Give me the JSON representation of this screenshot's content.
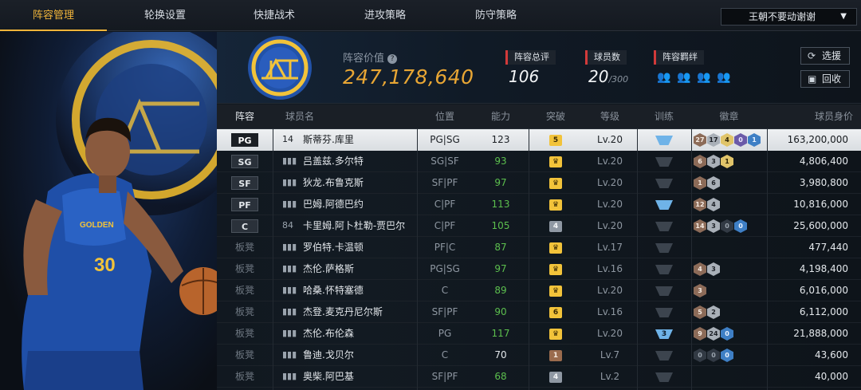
{
  "nav": {
    "tabs": [
      "阵容管理",
      "轮换设置",
      "快捷战术",
      "进攻策略",
      "防守策略"
    ],
    "active_tab": "阵容管理",
    "team_select": "王朝不要动谢谢"
  },
  "header": {
    "value_label": "阵容价值",
    "value": "247,178,640",
    "overall_label": "阵容总评",
    "overall": "106",
    "count_label": "球员数",
    "count": "20",
    "count_max": "/300",
    "chem_label": "阵容羁绊",
    "btn_pick": "选援",
    "btn_return": "回收"
  },
  "table": {
    "columns": [
      "阵容",
      "球员名",
      "位置",
      "能力",
      "突破",
      "等级",
      "训练",
      "徽章",
      "球员身价"
    ],
    "rows": [
      {
        "slot": "PG",
        "bench": false,
        "pic": "14",
        "name": "斯蒂芬.库里",
        "pos": "PG|SG",
        "ovr": "123",
        "ovr_color": "#1b1f24",
        "break": "5",
        "break_kind": "gold",
        "level": "Lv.20",
        "train": "blue",
        "train_num": "",
        "badges": [
          [
            "27",
            "br"
          ],
          [
            "17",
            "sv"
          ],
          [
            "4",
            "gd"
          ],
          [
            "0",
            "pu"
          ],
          [
            "1",
            "bl"
          ]
        ],
        "salary": "163,200,000",
        "selected": true
      },
      {
        "slot": "SG",
        "bench": false,
        "pic": "",
        "name": "吕盖兹.多尔特",
        "pos": "SG|SF",
        "ovr": "93",
        "ovr_color": "#5cbf4e",
        "break": "♛",
        "break_kind": "gold",
        "level": "Lv.20",
        "train": "dark",
        "train_num": "",
        "badges": [
          [
            "6",
            "br"
          ],
          [
            "3",
            "sv"
          ],
          [
            "1",
            "gd"
          ]
        ],
        "salary": "4,806,400"
      },
      {
        "slot": "SF",
        "bench": false,
        "pic": "",
        "name": "狄龙.布鲁克斯",
        "pos": "SF|PF",
        "ovr": "97",
        "ovr_color": "#5cbf4e",
        "break": "♛",
        "break_kind": "gold",
        "level": "Lv.20",
        "train": "dark",
        "train_num": "",
        "badges": [
          [
            "1",
            "br"
          ],
          [
            "6",
            "sv"
          ]
        ],
        "salary": "3,980,800"
      },
      {
        "slot": "PF",
        "bench": false,
        "pic": "",
        "name": "巴姆.阿德巴约",
        "pos": "C|PF",
        "ovr": "113",
        "ovr_color": "#5cbf4e",
        "break": "♛",
        "break_kind": "gold",
        "level": "Lv.20",
        "train": "blue",
        "train_num": "",
        "badges": [
          [
            "12",
            "br"
          ],
          [
            "4",
            "sv"
          ]
        ],
        "salary": "10,816,000"
      },
      {
        "slot": "C",
        "bench": false,
        "pic": "84",
        "name": "卡里姆.阿卜杜勒-贾巴尔",
        "pos": "C|PF",
        "ovr": "105",
        "ovr_color": "#5cbf4e",
        "break": "4",
        "break_kind": "silver",
        "level": "Lv.20",
        "train": "dark",
        "train_num": "",
        "badges": [
          [
            "14",
            "br"
          ],
          [
            "3",
            "sv"
          ],
          [
            "0",
            "dk"
          ],
          [
            "0",
            "bl"
          ]
        ],
        "salary": "25,600,000"
      },
      {
        "slot": "板凳",
        "bench": true,
        "pic": "",
        "name": "罗伯特.卡温顿",
        "pos": "PF|C",
        "ovr": "87",
        "ovr_color": "#5cbf4e",
        "break": "♛",
        "break_kind": "gold",
        "level": "Lv.17",
        "train": "dark",
        "train_num": "",
        "badges": [],
        "salary": "477,440"
      },
      {
        "slot": "板凳",
        "bench": true,
        "pic": "",
        "name": "杰伦.萨格斯",
        "pos": "PG|SG",
        "ovr": "97",
        "ovr_color": "#5cbf4e",
        "break": "♛",
        "break_kind": "gold",
        "level": "Lv.16",
        "train": "dark",
        "train_num": "",
        "badges": [
          [
            "4",
            "br"
          ],
          [
            "3",
            "sv"
          ]
        ],
        "salary": "4,198,400"
      },
      {
        "slot": "板凳",
        "bench": true,
        "pic": "",
        "name": "哈桑.怀特塞德",
        "pos": "C",
        "ovr": "89",
        "ovr_color": "#5cbf4e",
        "break": "♛",
        "break_kind": "gold",
        "level": "Lv.20",
        "train": "dark",
        "train_num": "",
        "badges": [
          [
            "3",
            "br"
          ]
        ],
        "salary": "6,016,000"
      },
      {
        "slot": "板凳",
        "bench": true,
        "pic": "",
        "name": "杰登.麦克丹尼尔斯",
        "pos": "SF|PF",
        "ovr": "90",
        "ovr_color": "#5cbf4e",
        "break": "6",
        "break_kind": "gold",
        "level": "Lv.16",
        "train": "dark",
        "train_num": "",
        "badges": [
          [
            "5",
            "br"
          ],
          [
            "2",
            "sv"
          ]
        ],
        "salary": "6,112,000"
      },
      {
        "slot": "板凳",
        "bench": true,
        "pic": "",
        "name": "杰伦.布伦森",
        "pos": "PG",
        "ovr": "117",
        "ovr_color": "#5cbf4e",
        "break": "♛",
        "break_kind": "gold",
        "level": "Lv.20",
        "train": "num",
        "train_num": "3",
        "badges": [
          [
            "9",
            "br"
          ],
          [
            "24",
            "sv"
          ],
          [
            "0",
            "bl"
          ]
        ],
        "salary": "21,888,000"
      },
      {
        "slot": "板凳",
        "bench": true,
        "pic": "",
        "name": "鲁迪.戈贝尔",
        "pos": "C",
        "ovr": "70",
        "ovr_color": "#e3e7eb",
        "break": "1",
        "break_kind": "bronze",
        "level": "Lv.7",
        "train": "dark",
        "train_num": "",
        "badges": [
          [
            "0",
            "dk"
          ],
          [
            "0",
            "dk"
          ],
          [
            "0",
            "bl"
          ]
        ],
        "salary": "43,600"
      },
      {
        "slot": "板凳",
        "bench": true,
        "pic": "",
        "name": "奥柴.阿巴基",
        "pos": "SF|PF",
        "ovr": "68",
        "ovr_color": "#5cbf4e",
        "break": "4",
        "break_kind": "silver",
        "level": "Lv.2",
        "train": "dark",
        "train_num": "",
        "badges": [],
        "salary": "40,000"
      }
    ]
  }
}
